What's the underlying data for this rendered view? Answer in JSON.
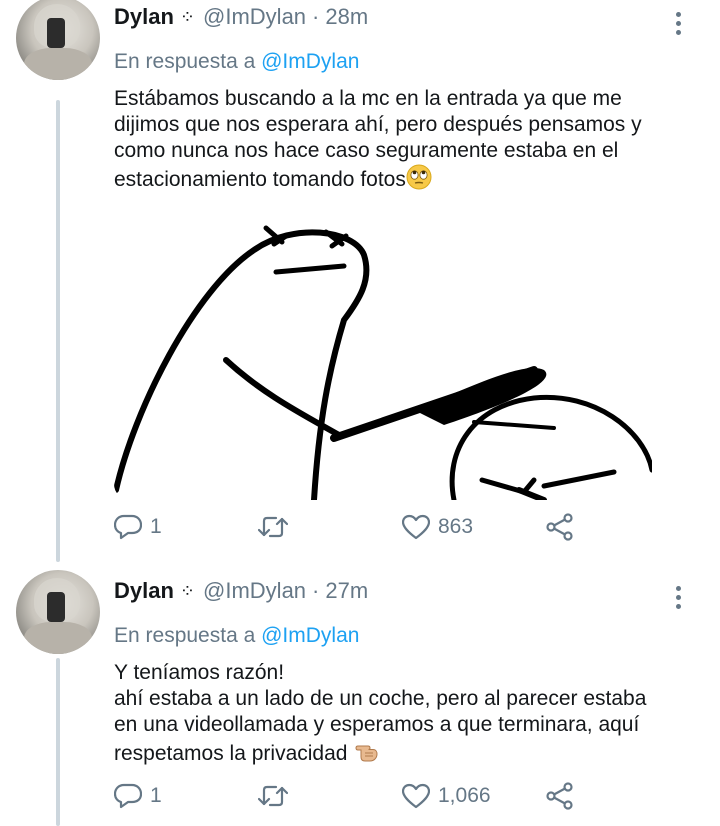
{
  "thread": [
    {
      "author": {
        "name": "Dylan",
        "badge": "⁘",
        "handle": "@ImDylan",
        "separator": "·",
        "time": "28m"
      },
      "reply": {
        "prefix": "En respuesta a",
        "mention": "@ImDylan"
      },
      "text_lines": [
        "Estábamos buscando a la mc en la entrada ya que me",
        "dijimos que nos esperara ahí, pero después pensamos y",
        "como nunca nos hace caso seguramente estaba en el",
        "estacionamiento tomando fotos"
      ],
      "emoji": "face-with-rolling-eyes",
      "media": {
        "kind": "meme-drawing",
        "description_icon": "flork-bat-meme"
      },
      "stats": {
        "replies": "1",
        "retweets": "",
        "likes": "863"
      }
    },
    {
      "author": {
        "name": "Dylan",
        "badge": "⁘",
        "handle": "@ImDylan",
        "separator": "·",
        "time": "27m"
      },
      "reply": {
        "prefix": "En respuesta a",
        "mention": "@ImDylan"
      },
      "text_lines": [
        "Y teníamos razón!",
        "ahí estaba a un lado de un coche, pero al parecer estaba",
        "en una videollamada y esperamos a que terminara, aquí",
        "respetamos la privacidad"
      ],
      "emoji": "hand-pointing-left",
      "stats": {
        "replies": "1",
        "retweets": "",
        "likes": "1,066"
      }
    }
  ],
  "colors": {
    "text": "#14171a",
    "muted": "#657786",
    "link": "#1da1f2",
    "thread_line": "#ccd6dd"
  }
}
